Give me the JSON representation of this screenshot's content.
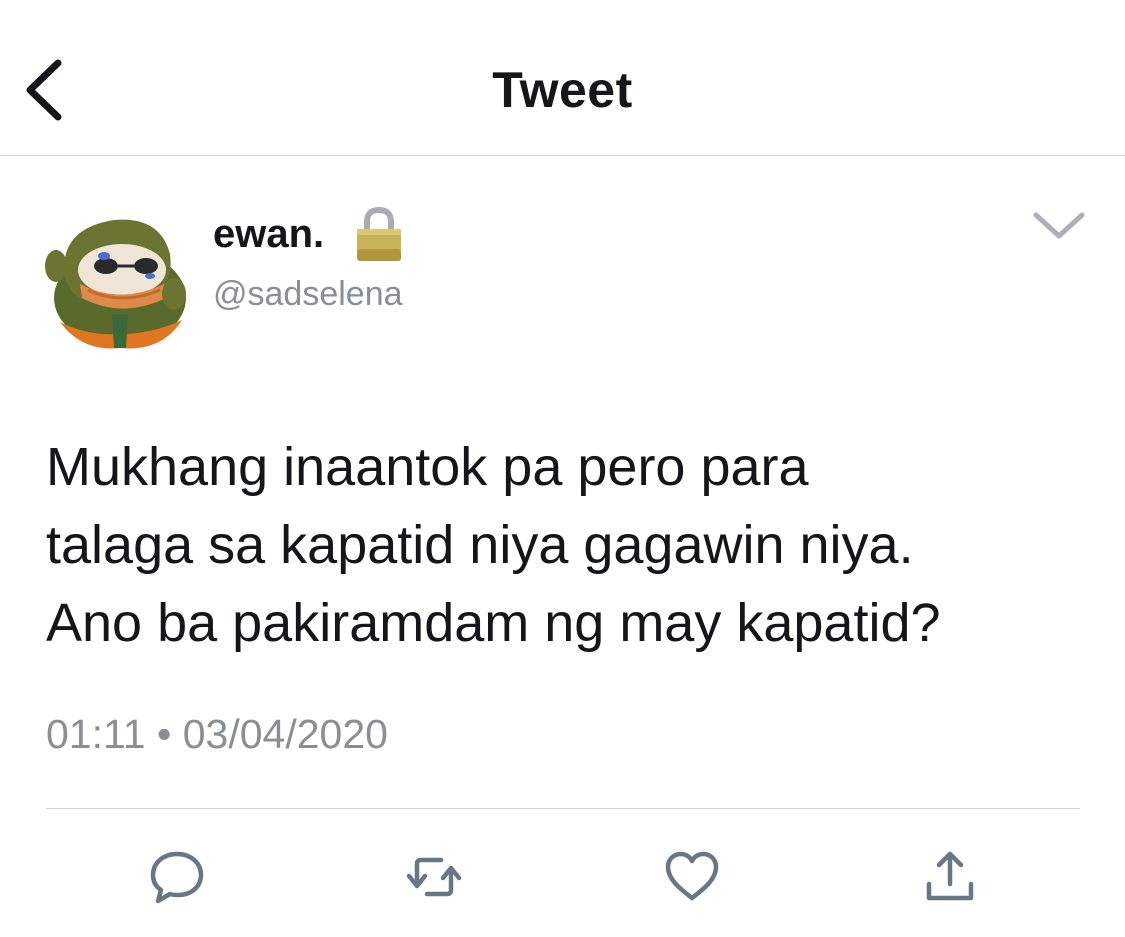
{
  "header": {
    "title": "Tweet",
    "back_icon": "chevron-left-icon"
  },
  "tweet": {
    "author": {
      "display_name": "ewan.",
      "handle": "@sadselena",
      "protected_icon": "lock-icon"
    },
    "text_lines": [
      "Mukhang inaantok pa pero para",
      "talaga sa kapatid niya gagawin niya.",
      "Ano ba pakiramdam ng may kapatid?"
    ],
    "time": "01:11",
    "separator": "•",
    "date": "03/04/2020"
  },
  "actions": {
    "reply_icon": "reply-icon",
    "retweet_icon": "retweet-icon",
    "like_icon": "heart-icon",
    "share_icon": "share-icon"
  },
  "colors": {
    "text": "#14171a",
    "secondary_text": "#8a8f94",
    "icon": "#687785",
    "divider": "#d0d3d6"
  }
}
